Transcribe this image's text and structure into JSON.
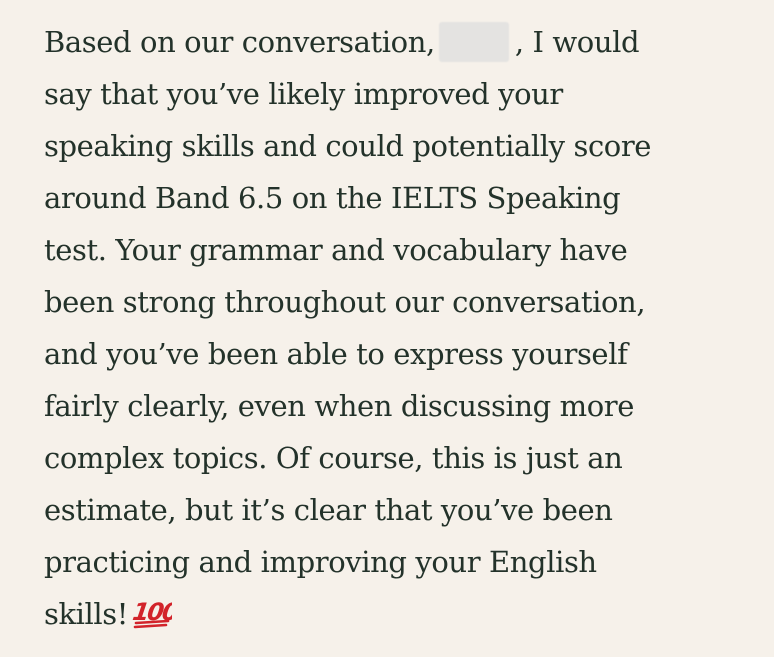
{
  "message": {
    "line1_before": "Based on our conversation,",
    "line1_after": ", I would",
    "lines": [
      "say that you’ve likely improved your",
      "speaking skills and could potentially score",
      "around Band 6.5 on the IELTS Speaking",
      "test. Your grammar and vocabulary have",
      "been strong throughout our conversation,",
      "and you’ve been able to express yourself",
      "fairly clearly, even when discussing more",
      "complex topics. Of course, this is just an",
      "estimate, but it’s clear that you’ve been",
      "practicing and improving your English"
    ],
    "last_line": "skills!",
    "emoji_text": "100",
    "emoji_icon": "hundred-points-emoji"
  },
  "colors": {
    "background": "#f6f1ea",
    "text": "#23322a",
    "emoji_red": "#d2232a",
    "redaction": "#e4e3e1"
  }
}
